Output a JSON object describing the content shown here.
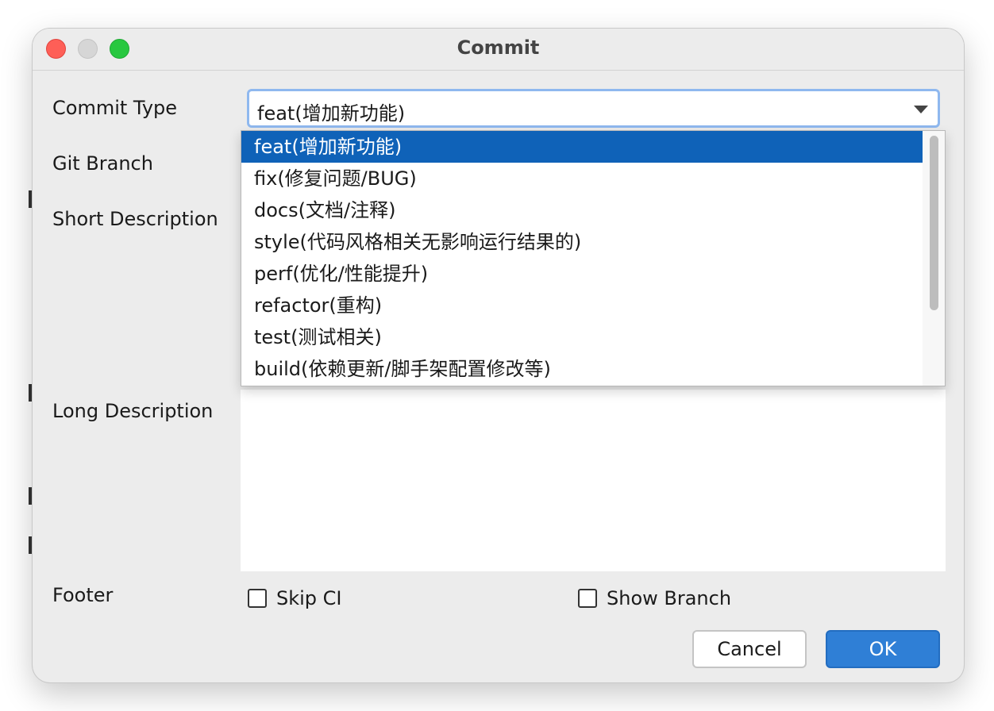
{
  "window": {
    "title": "Commit"
  },
  "form": {
    "commit_type_label": "Commit Type",
    "git_branch_label": "Git Branch",
    "short_description_label": "Short Description",
    "long_description_label": "Long Description",
    "footer_label": "Footer"
  },
  "commit_type": {
    "selected": "feat(增加新功能)",
    "options": [
      "feat(增加新功能)",
      "fix(修复问题/BUG)",
      "docs(文档/注释)",
      "style(代码风格相关无影响运行结果的)",
      "perf(优化/性能提升)",
      "refactor(重构)",
      "test(测试相关)",
      "build(依赖更新/脚手架配置修改等)"
    ]
  },
  "footer": {
    "skip_ci_label": "Skip CI",
    "skip_ci_checked": false,
    "show_branch_label": "Show Branch",
    "show_branch_checked": false
  },
  "buttons": {
    "cancel": "Cancel",
    "ok": "OK"
  },
  "colors": {
    "window_bg": "#ececec",
    "selection": "#0f62b8",
    "ok_button": "#2f7fd6",
    "close": "#fe5f57",
    "maximize": "#28c840",
    "focus_ring": "#8fb8ef"
  }
}
